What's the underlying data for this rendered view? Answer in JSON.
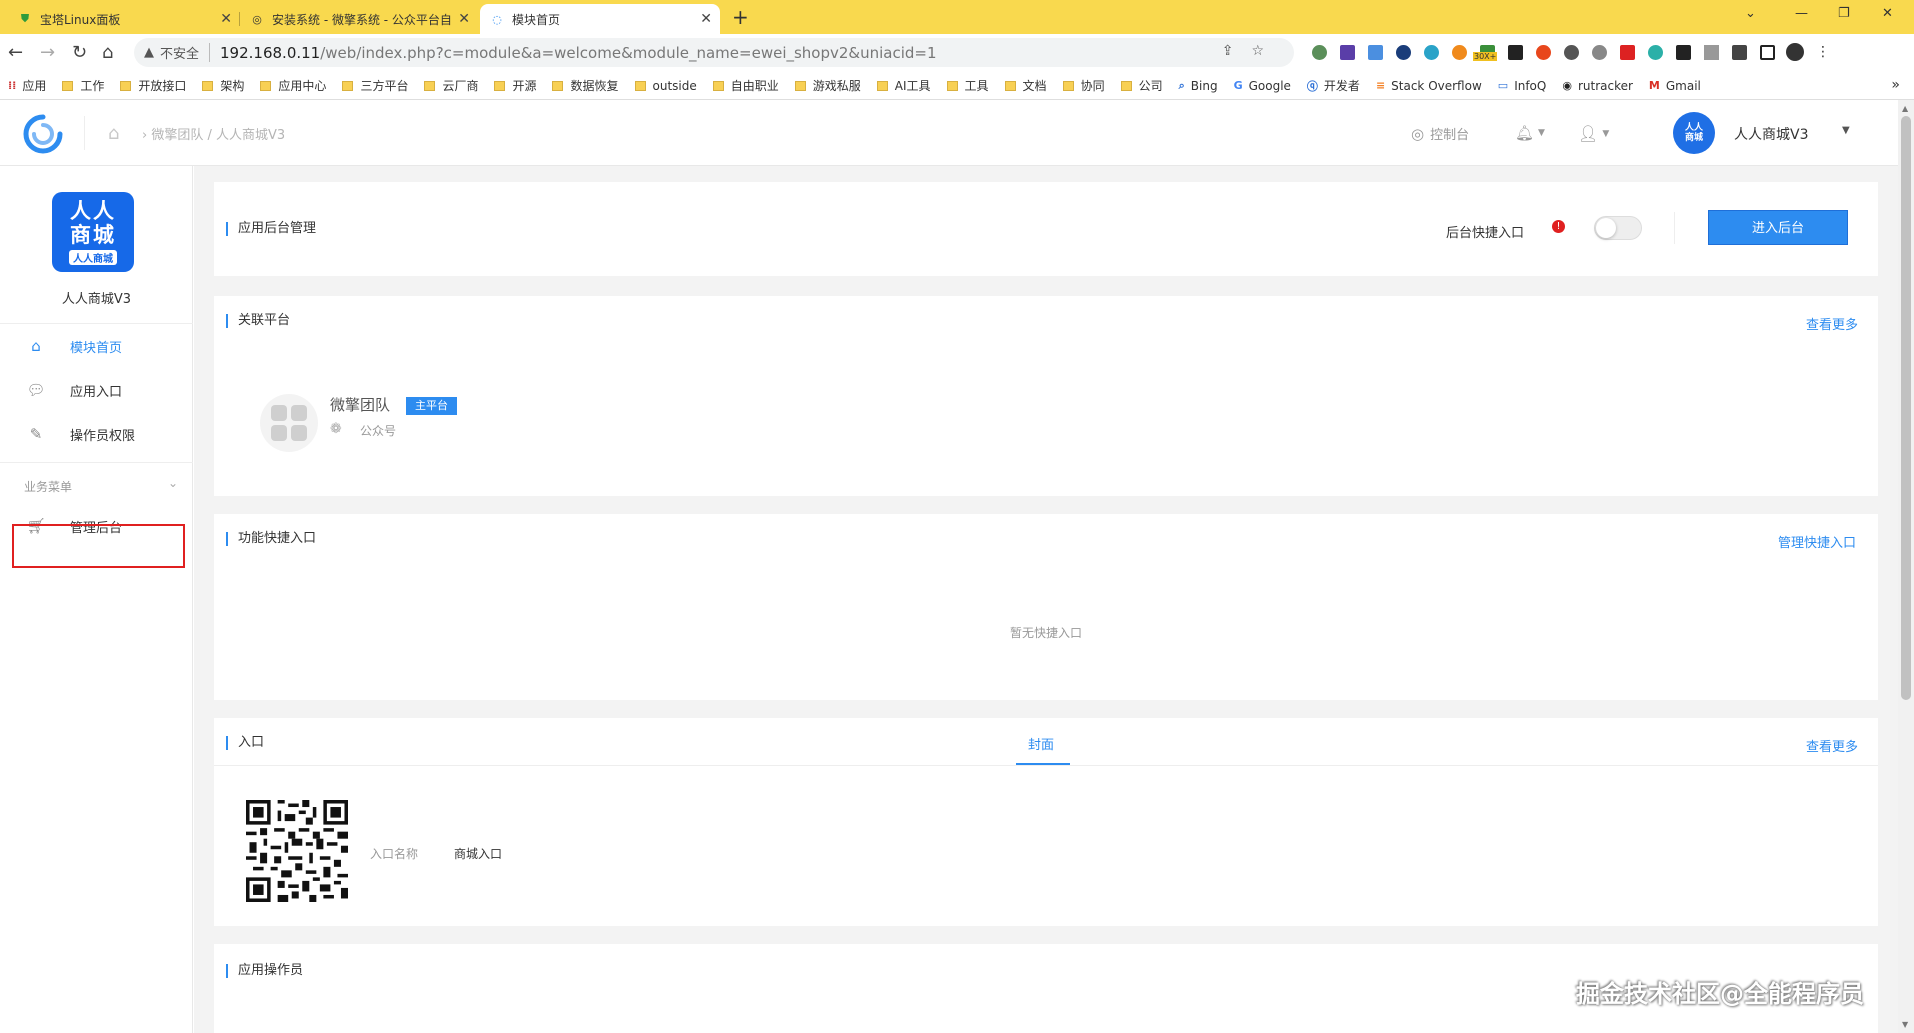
{
  "browser": {
    "tabs": [
      {
        "title": "宝塔Linux面板",
        "active": false
      },
      {
        "title": "安装系统 - 微擎系统 - 公众平台自助",
        "active": false
      },
      {
        "title": "模块首页",
        "active": true
      }
    ],
    "address": {
      "security_label": "不安全",
      "url_host": "192.168.0.11",
      "url_rest": "/web/index.php?c=module&a=welcome&module_name=ewei_shopv2&uniacid=1"
    },
    "extension_badge": "30X+",
    "bookmarks": [
      "应用",
      "工作",
      "开放接口",
      "架构",
      "应用中心",
      "三方平台",
      "云厂商",
      "开源",
      "数据恢复",
      "outside",
      "自由职业",
      "游戏私服",
      "AI工具",
      "工具",
      "文档",
      "协同",
      "公司",
      "Bing",
      "Google",
      "开发者",
      "Stack Overflow",
      "InfoQ",
      "rutracker",
      "Gmail"
    ]
  },
  "header": {
    "breadcrumb": "微擎团队 / 人人商城V3",
    "console_label": "控制台",
    "avatar_text_1": "人人",
    "avatar_text_2": "商城",
    "shop_name": "人人商城V3"
  },
  "sidebar": {
    "logo_line1": "人人",
    "logo_line2": "商城",
    "logo_line3": "人人商城",
    "title": "人人商城V3",
    "items": [
      {
        "label": "模块首页",
        "icon": "home-icon",
        "active": true
      },
      {
        "label": "应用入口",
        "icon": "chat-icon",
        "active": false
      },
      {
        "label": "操作员权限",
        "icon": "edit-doc-icon",
        "active": false
      }
    ],
    "group_label": "业务菜单",
    "group_items": [
      {
        "label": "管理后台",
        "icon": "cart-icon"
      }
    ]
  },
  "main": {
    "admin_card": {
      "title": "应用后台管理",
      "quick_entry_label": "后台快捷入口",
      "toggle_on": false,
      "enter_button": "进入后台"
    },
    "platform_card": {
      "title": "关联平台",
      "more_link": "查看更多",
      "platform_name": "微擎团队",
      "platform_badge": "主平台",
      "platform_type": "公众号"
    },
    "shortcut_card": {
      "title": "功能快捷入口",
      "manage_link": "管理快捷入口",
      "empty_text": "暂无快捷入口"
    },
    "entry_card": {
      "title": "入口",
      "tab_label": "封面",
      "more_link": "查看更多",
      "entry_name_label": "入口名称",
      "entry_name_value": "商城入口"
    },
    "operator_card": {
      "title": "应用操作员"
    }
  },
  "watermark": "掘金技术社区@全能程序员",
  "colors": {
    "accent": "#2d8cf0",
    "tabbar": "#f9d94e",
    "highlight_box": "#e02020"
  }
}
